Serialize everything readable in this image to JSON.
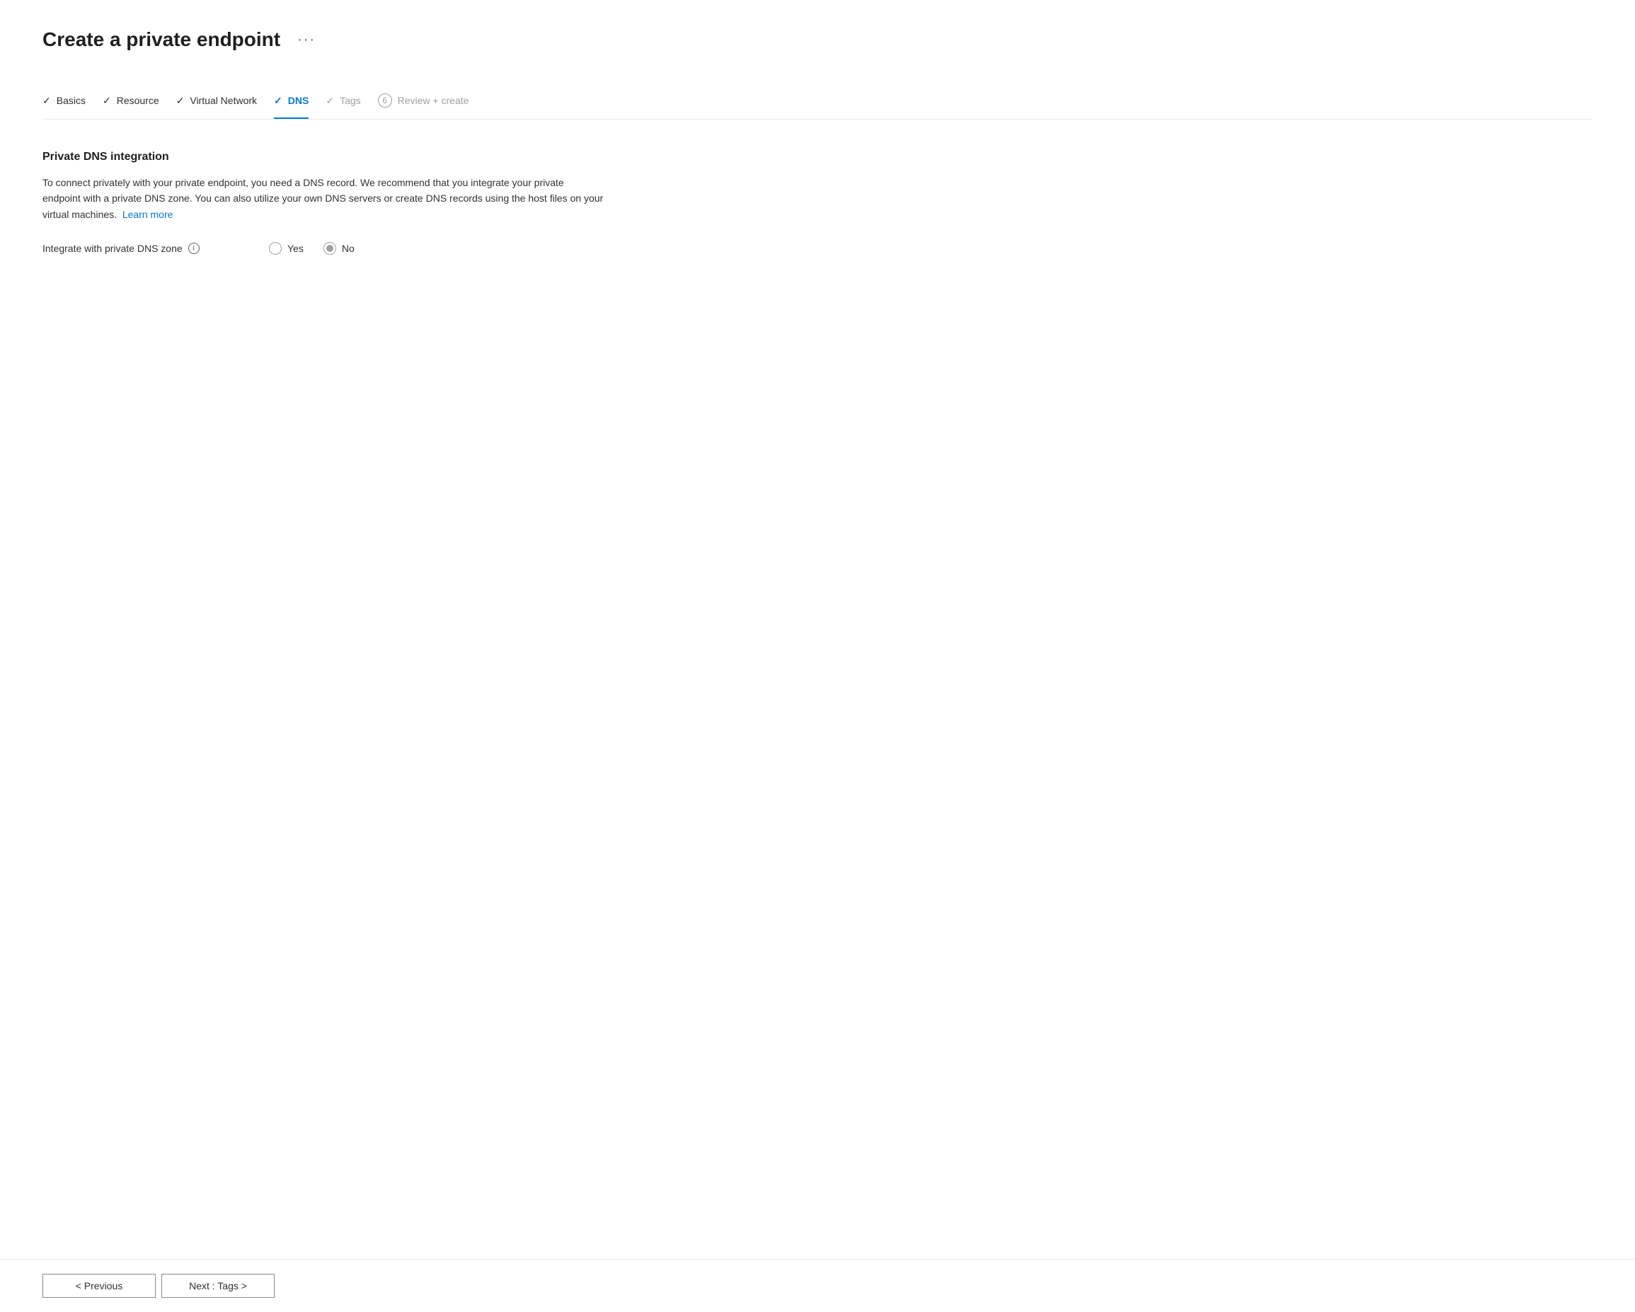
{
  "page": {
    "title": "Create a private endpoint",
    "more_options_label": "···"
  },
  "wizard": {
    "steps": [
      {
        "id": "basics",
        "label": "Basics",
        "status": "completed",
        "prefix": "✓",
        "number": null
      },
      {
        "id": "resource",
        "label": "Resource",
        "status": "completed",
        "prefix": "✓",
        "number": null
      },
      {
        "id": "virtual-network",
        "label": "Virtual Network",
        "status": "completed",
        "prefix": "✓",
        "number": null
      },
      {
        "id": "dns",
        "label": "DNS",
        "status": "active",
        "prefix": "✓",
        "number": null
      },
      {
        "id": "tags",
        "label": "Tags",
        "status": "disabled",
        "prefix": "✓",
        "number": null
      },
      {
        "id": "review-create",
        "label": "Review + create",
        "status": "disabled",
        "prefix": null,
        "number": "6"
      }
    ]
  },
  "content": {
    "section_title": "Private DNS integration",
    "description_line1": "To connect privately with your private endpoint, you need a DNS record. We recommend that you integrate your private",
    "description_line2": "endpoint with a private DNS zone. You can also utilize your own DNS servers or create DNS records using the host files on your",
    "description_line3": "virtual machines.",
    "learn_more_label": "Learn more",
    "form_label": "Integrate with private DNS zone",
    "info_icon_label": "i",
    "radio_options": [
      {
        "id": "yes",
        "label": "Yes",
        "selected": false
      },
      {
        "id": "no",
        "label": "No",
        "selected": true
      }
    ]
  },
  "footer": {
    "previous_label": "< Previous",
    "next_label": "Next : Tags >"
  }
}
